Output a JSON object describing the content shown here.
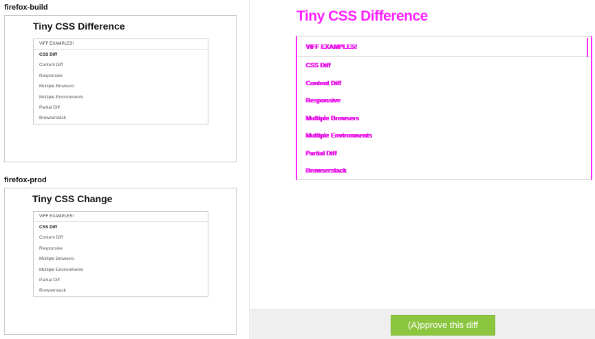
{
  "environments": [
    {
      "label": "firefox-build",
      "page_title": "Tiny CSS Difference",
      "menu_header": "VIFF EXAMPLES!",
      "menu_items": [
        "CSS Diff",
        "Content Diff",
        "Responsive",
        "Multiple Browsers",
        "Multiple Environments",
        "Partial Diff",
        "Browserstack"
      ]
    },
    {
      "label": "firefox-prod",
      "page_title": "Tiny CSS Change",
      "menu_header": "VIFF EXAMPLES!",
      "menu_items": [
        "CSS Diff",
        "Content Diff",
        "Responsive",
        "Multiple Browsers",
        "Multiple Environments",
        "Partial Diff",
        "Browserstack"
      ]
    }
  ],
  "diff": {
    "title": "Tiny CSS Difference",
    "menu_header": "VIFF EXAMPLES!",
    "menu_items": [
      "CSS Diff",
      "Content Diff",
      "Responsive",
      "Multiple Browsers",
      "Multiple Environments",
      "Partial Diff",
      "Browserstack"
    ],
    "highlight_color": "#ff22ff"
  },
  "actions": {
    "approve_label": "(A)pprove this diff",
    "approve_color": "#8cc63f"
  }
}
